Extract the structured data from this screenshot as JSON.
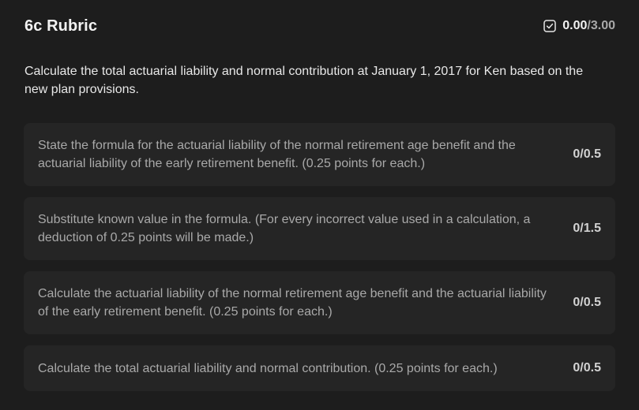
{
  "header": {
    "title": "6c Rubric",
    "score_icon": "checkbox-check-icon",
    "score_earned": "0.00",
    "score_max": "/3.00"
  },
  "question": {
    "text": "Calculate the total actuarial liability and normal contribution at January 1, 2017 for Ken based on the new plan provisions."
  },
  "criteria": [
    {
      "text": "State the formula for the actuarial liability of the normal retirement age benefit and the actuarial liability of the early retirement benefit. (0.25 points for each.)",
      "points": "0/0.5"
    },
    {
      "text": "Substitute known value in the formula. (For every incorrect value used in a calculation, a deduction of 0.25 points will be made.)",
      "points": "0/1.5"
    },
    {
      "text": "Calculate the actuarial liability of the normal retirement age benefit and the actuarial liability of the early retirement benefit. (0.25 points for each.)",
      "points": "0/0.5"
    },
    {
      "text": "Calculate the total actuarial liability and normal contribution. (0.25 points for each.)",
      "points": "0/0.5"
    }
  ],
  "colors": {
    "background": "#1d1d1d",
    "card": "#252525",
    "text_primary": "#e8e8e8",
    "text_secondary": "#a9a9a9"
  }
}
